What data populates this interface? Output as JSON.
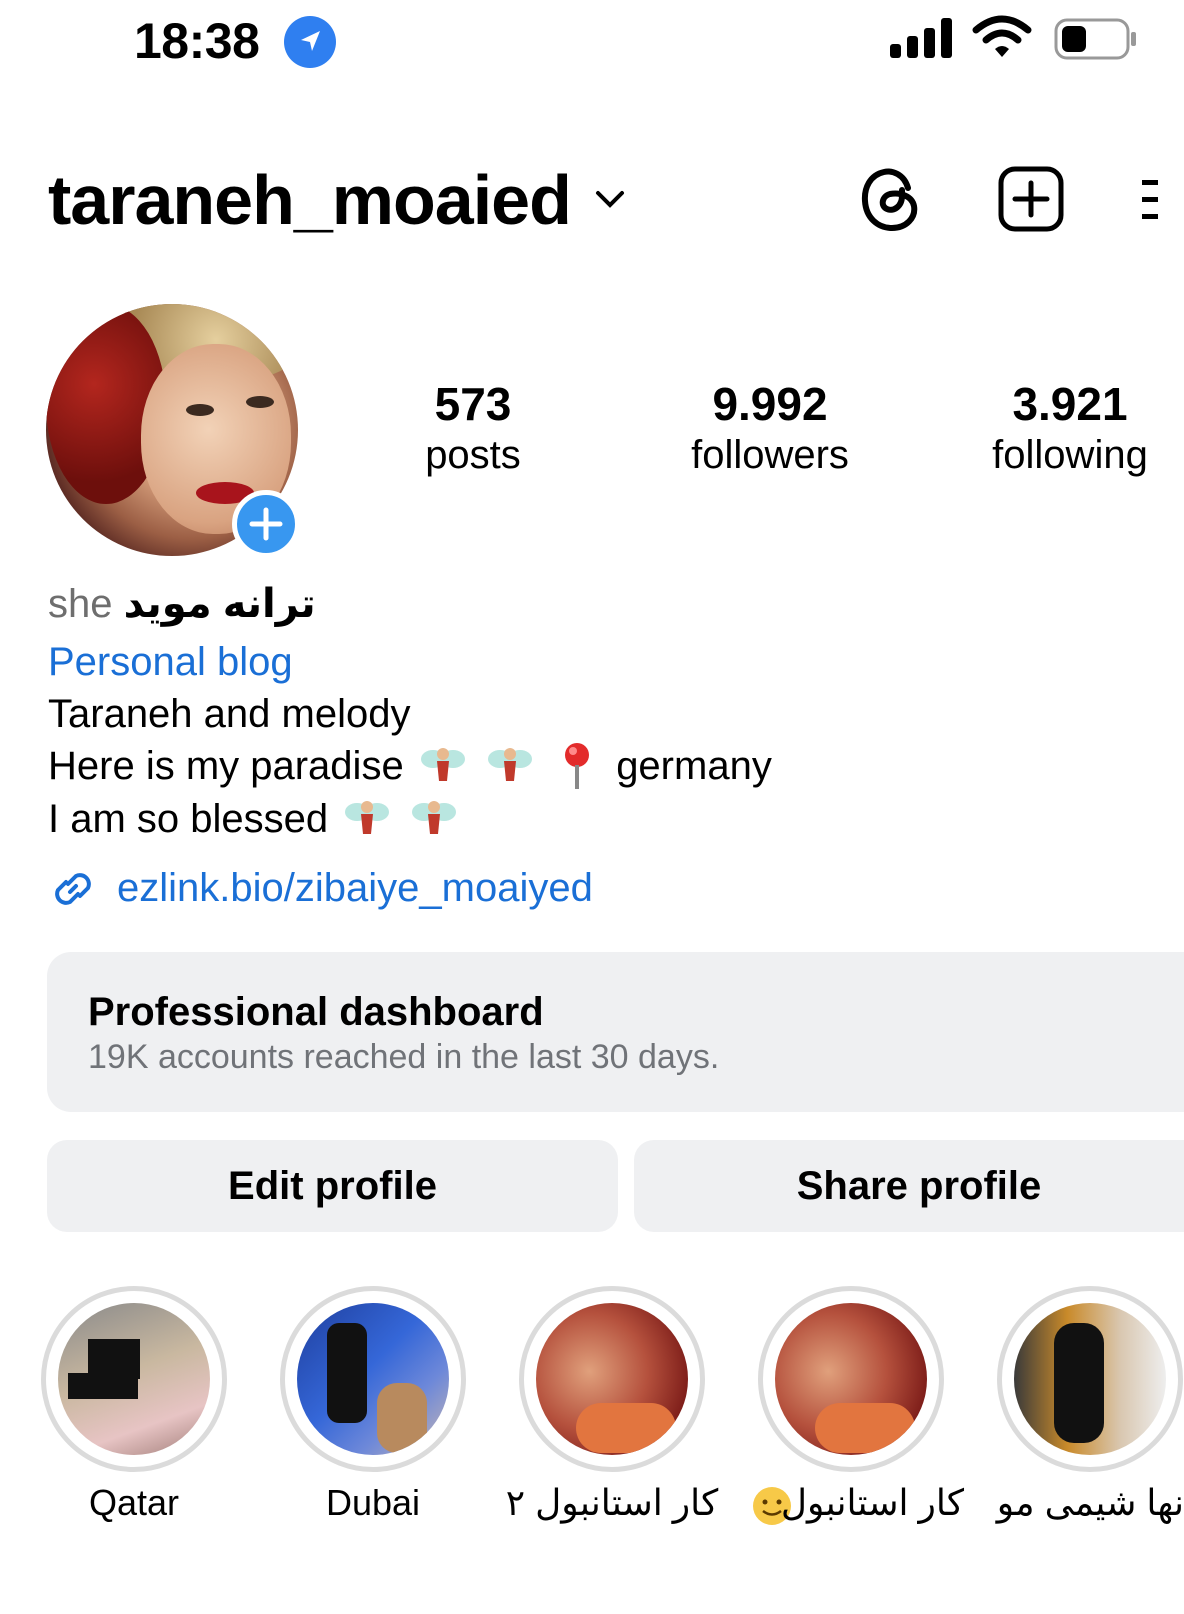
{
  "status_bar": {
    "time": "18:38",
    "location_icon": "location-arrow-icon",
    "signal_icon": "cellular-signal-icon",
    "wifi_icon": "wifi-icon",
    "battery_icon": "battery-icon"
  },
  "header": {
    "username": "taraneh_moaied",
    "account_switch_icon": "chevron-down-icon",
    "threads_icon": "threads-icon",
    "create_icon": "plus-square-icon",
    "menu_icon": "hamburger-menu-icon"
  },
  "profile": {
    "avatar": "profile-photo",
    "add_story_icon": "plus-icon",
    "stats": [
      {
        "value": "573",
        "label": "posts"
      },
      {
        "value": "9.992",
        "label": "followers"
      },
      {
        "value": "3.921",
        "label": "following"
      }
    ]
  },
  "bio": {
    "pronoun": "she",
    "display_name": "ترانه موید",
    "category": "Personal blog",
    "line1": "Taraneh and melody",
    "line2_text": "Here is my paradise",
    "line2_suffix": "germany",
    "line3_text": "I am so blessed",
    "link": "ezlink.bio/zibaiye_moaiyed",
    "link_icon": "link-icon"
  },
  "dashboard": {
    "title": "Professional dashboard",
    "subtitle": "19K accounts reached in the last 30 days."
  },
  "buttons": {
    "edit": "Edit profile",
    "share": "Share profile"
  },
  "highlights": [
    {
      "label": "Qatar"
    },
    {
      "label": "Dubai"
    },
    {
      "label": "کار استانبول ۲"
    },
    {
      "label": "کار استانبول"
    },
    {
      "label": "نها شیمی مو"
    }
  ],
  "colors": {
    "link": "#1a6fd6",
    "accent_blue": "#3897f0",
    "button_bg": "#eff0f2",
    "muted": "#707378"
  }
}
